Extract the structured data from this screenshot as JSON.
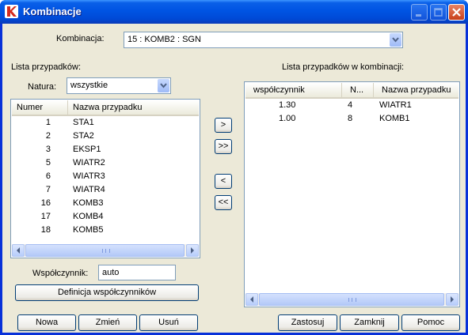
{
  "window": {
    "title": "Kombinacje"
  },
  "combination": {
    "label": "Kombinacja:",
    "selected": "15 : KOMB2 : SGN"
  },
  "left": {
    "section_label": "Lista przypadków:",
    "natura_label": "Natura:",
    "natura_value": "wszystkie",
    "columns": [
      "Numer",
      "Nazwa przypadku"
    ],
    "rows": [
      {
        "num": "1",
        "name": "STA1"
      },
      {
        "num": "2",
        "name": "STA2"
      },
      {
        "num": "3",
        "name": "EKSP1"
      },
      {
        "num": "5",
        "name": "WIATR2"
      },
      {
        "num": "6",
        "name": "WIATR3"
      },
      {
        "num": "7",
        "name": "WIATR4"
      },
      {
        "num": "16",
        "name": "KOMB3"
      },
      {
        "num": "17",
        "name": "KOMB4"
      },
      {
        "num": "18",
        "name": "KOMB5"
      }
    ],
    "factor_label": "Współczynnik:",
    "factor_value": "auto",
    "definition_button": "Definicja współczynników"
  },
  "transfer": {
    "add": ">",
    "add_all": ">>",
    "remove": "<",
    "remove_all": "<<"
  },
  "right": {
    "section_label": "Lista przypadków w kombinacji:",
    "columns": [
      "współczynnik",
      "N...",
      "Nazwa przypadku"
    ],
    "rows": [
      {
        "factor": "1.30",
        "num": "4",
        "name": "WIATR1"
      },
      {
        "factor": "1.00",
        "num": "8",
        "name": "KOMB1"
      }
    ]
  },
  "buttons": {
    "new": "Nowa",
    "change": "Zmień",
    "delete": "Usuń",
    "apply": "Zastosuj",
    "close": "Zamknij",
    "help": "Pomoc"
  },
  "colors": {
    "titlebar": "#0054e3",
    "client": "#ece9d8",
    "close_button": "#c8401a"
  }
}
